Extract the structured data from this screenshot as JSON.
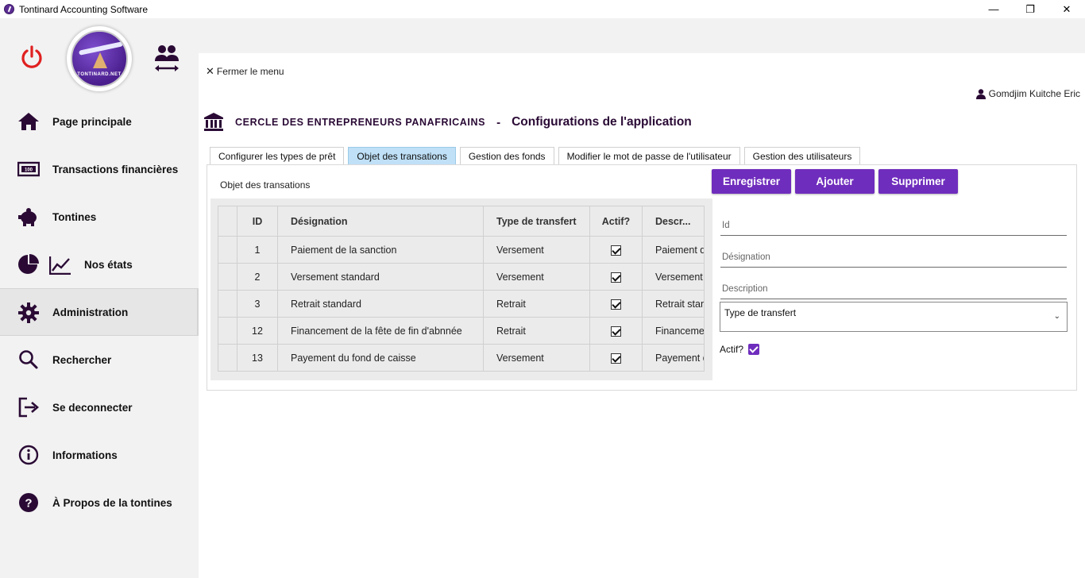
{
  "window": {
    "title": "Tontinard Accounting Software",
    "controls": [
      "—",
      "❐",
      "✕"
    ]
  },
  "sidebar": {
    "logo_text": "TONTINARD.NET",
    "items": [
      {
        "label": "Page principale",
        "icon": "home-icon"
      },
      {
        "label": "Transactions financières",
        "icon": "banknote-icon"
      },
      {
        "label": "Tontines",
        "icon": "piggy-bank-icon"
      },
      {
        "label": "Nos états",
        "icon": "pie-chart-icon"
      },
      {
        "label": "Administration",
        "icon": "gear-icon"
      },
      {
        "label": "Rechercher",
        "icon": "search-icon"
      },
      {
        "label": "Se deconnecter",
        "icon": "logout-icon"
      },
      {
        "label": "Informations",
        "icon": "info-icon"
      },
      {
        "label": "À Propos de la  tontines",
        "icon": "help-icon"
      }
    ],
    "active_item": "Administration"
  },
  "main": {
    "close_menu": "Fermer le menu",
    "user_name": "Gomdjim Kuitche Eric",
    "org_name": "CERCLE DES ENTREPRENEURS PANAFRICAINS",
    "separator": "-",
    "page_title": "Configurations de l'application",
    "tabs": [
      {
        "label": "Configurer les types de prêt"
      },
      {
        "label": "Objet des transations"
      },
      {
        "label": "Gestion des fonds"
      },
      {
        "label": "Modifier le mot de passe de l'utilisateur"
      },
      {
        "label": "Gestion des utilisateurs"
      }
    ],
    "active_tab": "Objet des transations",
    "section_label": "Objet des transations",
    "buttons": {
      "save": "Enregistrer",
      "add": "Ajouter",
      "delete": "Supprimer"
    },
    "grid": {
      "columns": [
        "ID",
        "Désignation",
        "Type de transfert",
        "Actif?",
        "Descr..."
      ],
      "rows": [
        {
          "id": "1",
          "designation": "Paiement de la sanction",
          "type": "Versement",
          "actif": true,
          "description": "Paiement de la sanction"
        },
        {
          "id": "2",
          "designation": "Versement standard",
          "type": "Versement",
          "actif": true,
          "description": "Versement standard"
        },
        {
          "id": "3",
          "designation": "Retrait standard",
          "type": "Retrait",
          "actif": true,
          "description": "Retrait standard"
        },
        {
          "id": "12",
          "designation": "Financement de la fête de fin d'abnnée",
          "type": "Retrait",
          "actif": true,
          "description": "Financement de la fête"
        },
        {
          "id": "13",
          "designation": "Payement du fond de caisse",
          "type": "Versement",
          "actif": true,
          "description": "Payement du fond de caisse"
        }
      ]
    },
    "form": {
      "id_placeholder": "Id",
      "designation_placeholder": "Désignation",
      "description_placeholder": "Description",
      "type_select_value": "Type de transfert",
      "actif_label": "Actif?",
      "actif_checked": true
    }
  },
  "colors": {
    "accent": "#6f2dbd",
    "active_tab": "#bfe0f7",
    "power": "#e02020",
    "heading": "#2a0a35"
  }
}
